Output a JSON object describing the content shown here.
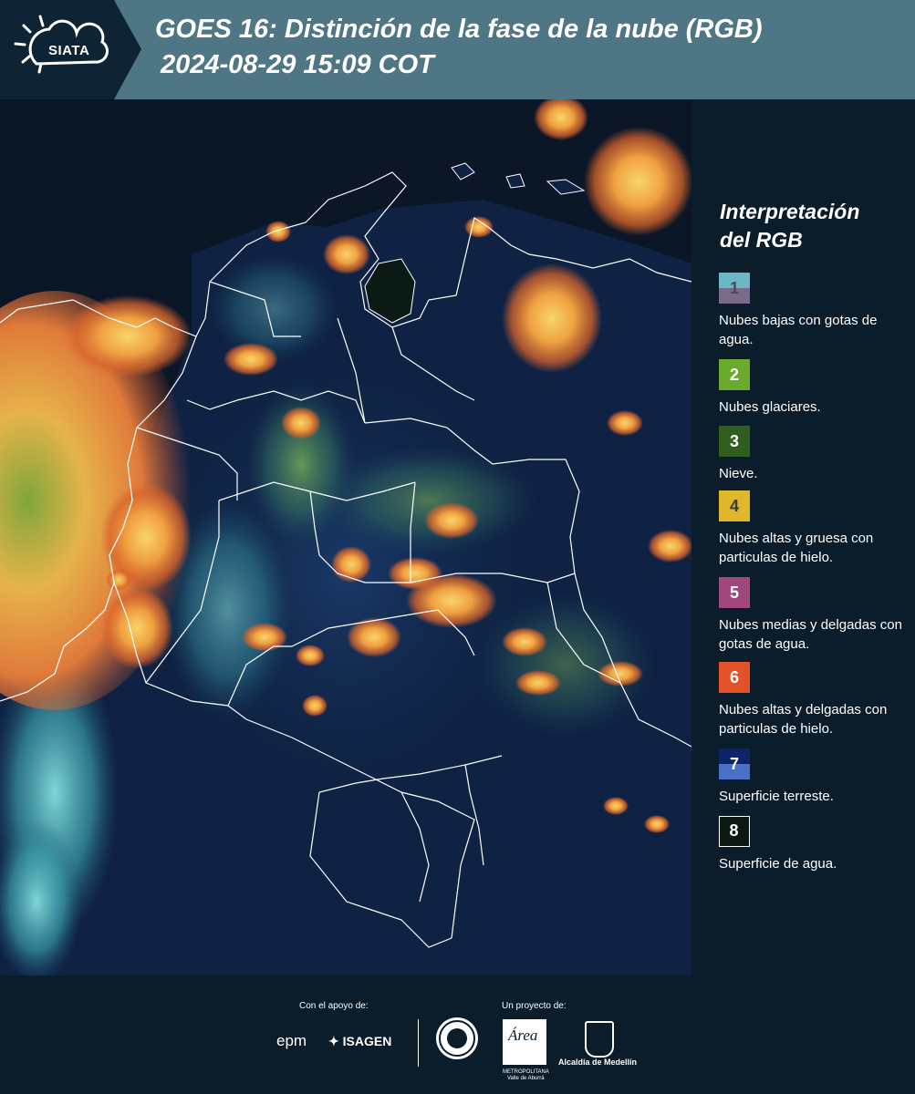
{
  "header": {
    "logo_text": "SIATA",
    "title": "GOES 16: Distinción de la fase de la nube (RGB)",
    "subtitle": "2024-08-29 15:09 COT"
  },
  "legend": {
    "title_line1": "Interpretación",
    "title_line2": "del RGB",
    "items": [
      {
        "num": "1",
        "label": "Nubes bajas con gotas de agua.",
        "colors": [
          "#6cb7c6",
          "#7c6a8a"
        ],
        "num_color": "#4a4a5a"
      },
      {
        "num": "2",
        "label": "Nubes glaciares.",
        "colors": [
          "#6aaa2d"
        ],
        "num_color": "#ffffff"
      },
      {
        "num": "3",
        "label": "Nieve.",
        "colors": [
          "#2f5e1f"
        ],
        "num_color": "#ffffff"
      },
      {
        "num": "4",
        "label": "Nubes altas y gruesa con particulas de hielo.",
        "colors": [
          "#e0b62a"
        ],
        "num_color": "#3a3a3a"
      },
      {
        "num": "5",
        "label": "Nubes medias y delgadas con gotas de agua.",
        "colors": [
          "#a0487e"
        ],
        "num_color": "#ffffff"
      },
      {
        "num": "6",
        "label": "Nubes altas y delgadas con particulas de hielo.",
        "colors": [
          "#e2532a"
        ],
        "num_color": "#ffffff"
      },
      {
        "num": "7",
        "label": "Superficie terreste.",
        "colors": [
          "#0e2468",
          "#4a70c8"
        ],
        "num_color": "#ffffff"
      },
      {
        "num": "8",
        "label": "Superficie de agua.",
        "colors": [
          "#0c1a12"
        ],
        "num_color": "#ffffff"
      }
    ]
  },
  "footer": {
    "support_label": "Con el apoyo de:",
    "project_label": "Un proyecto de:",
    "sponsor1": "epm",
    "sponsor2": "ISAGEN",
    "area_label": "Área",
    "area_sub1": "METROPOLITANA",
    "area_sub2": "Valle de Aburrá",
    "alcaldia": "Alcaldía de Medellín"
  },
  "colors": {
    "header_bg": "#4f7685",
    "panel_bg": "#0b1c2a"
  }
}
